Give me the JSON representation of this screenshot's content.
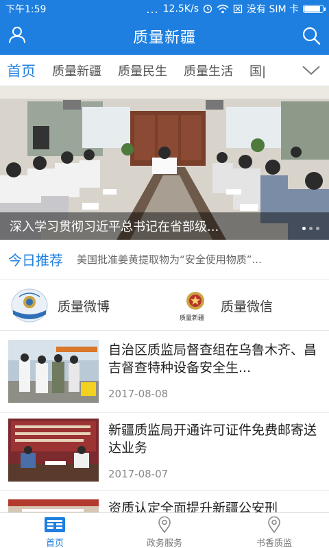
{
  "status_bar": {
    "time": "下午1:59",
    "more": "...",
    "speed": "12.5K/s",
    "sim_text": "没有 SIM 卡",
    "battery_level": 0.9
  },
  "header": {
    "title": "质量新疆",
    "user_icon": "user-icon",
    "search_icon": "search-icon"
  },
  "tabs": {
    "items": [
      {
        "label": "首页",
        "active": true
      },
      {
        "label": "质量新疆"
      },
      {
        "label": "质量民生"
      },
      {
        "label": "质量生活"
      },
      {
        "label": "国|"
      }
    ],
    "more_icon": "chevron-down-icon"
  },
  "banner": {
    "caption": "深入学习贯彻习近平总书记在省部级...",
    "page_count": 3,
    "active_index": 0
  },
  "today": {
    "label": "今日推荐",
    "headline": "美国批准姜黄提取物为“安全使用物质”..."
  },
  "social": {
    "weibo_label": "质量微博",
    "weixin_label": "质量微信",
    "weixin_logo_text": "质量新疆"
  },
  "news": [
    {
      "title": "自治区质监局督查组在乌鲁木齐、昌吉督查特种设备安全生...",
      "date": "2017-08-08"
    },
    {
      "title": "新疆质监局开通许可证件免费邮寄送达业务",
      "date": "2017-08-07"
    },
    {
      "title": "资质认定全面提升新疆公安刑",
      "date": ""
    }
  ],
  "bottom_nav": [
    {
      "label": "首页",
      "icon": "home-grid-icon",
      "active": true
    },
    {
      "label": "政务服务",
      "icon": "location-pin-icon"
    },
    {
      "label": "书香质监",
      "icon": "location-pin-icon"
    }
  ],
  "colors": {
    "primary": "#1e7fe0",
    "text": "#222222",
    "muted": "#888888"
  }
}
